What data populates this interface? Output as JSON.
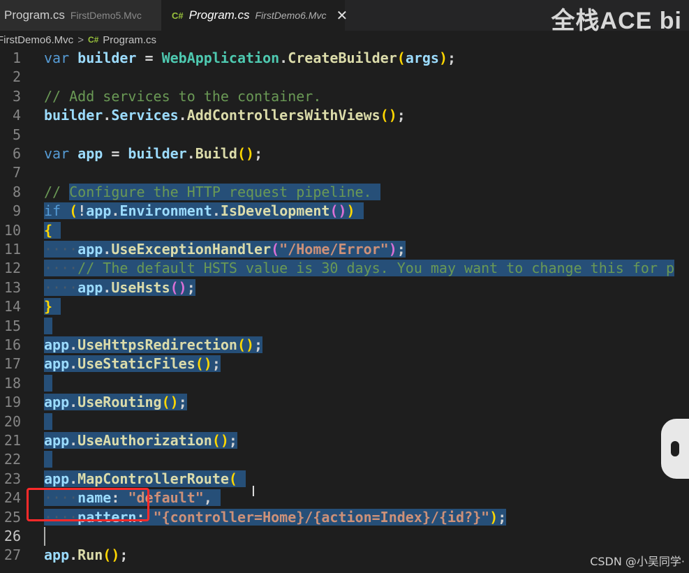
{
  "tabs": [
    {
      "filename": "Program.cs",
      "project": "FirstDemo5.Mvc",
      "active": false
    },
    {
      "icon": "C#",
      "filename": "Program.cs",
      "project": "FirstDemo6.Mvc",
      "active": true,
      "close": "✕"
    }
  ],
  "watermark": "全栈ACE bi",
  "breadcrumb": {
    "project": "FirstDemo6.Mvc",
    "separator": ">",
    "icon": "C#",
    "file": "Program.cs"
  },
  "active_line": 26,
  "csdn": "CSDN @小吴同学·",
  "lines": [
    {
      "n": "1",
      "segs": [
        [
          "kw",
          "var"
        ],
        [
          "plain",
          " "
        ],
        [
          "ident",
          "builder"
        ],
        [
          "plain",
          " = "
        ],
        [
          "cls",
          "WebApplication"
        ],
        [
          "plain",
          "."
        ],
        [
          "fn",
          "CreateBuilder"
        ],
        [
          "p1",
          "("
        ],
        [
          "ident",
          "args"
        ],
        [
          "p1",
          ")"
        ],
        [
          "plain",
          ";"
        ]
      ]
    },
    {
      "n": "2",
      "segs": []
    },
    {
      "n": "3",
      "segs": [
        [
          "cmt",
          "// Add services to the container."
        ]
      ]
    },
    {
      "n": "4",
      "segs": [
        [
          "ident",
          "builder"
        ],
        [
          "plain",
          "."
        ],
        [
          "ident",
          "Services"
        ],
        [
          "plain",
          "."
        ],
        [
          "fn",
          "AddControllersWithViews"
        ],
        [
          "p1",
          "()"
        ],
        [
          "plain",
          ";"
        ]
      ]
    },
    {
      "n": "5",
      "segs": []
    },
    {
      "n": "6",
      "segs": [
        [
          "kw",
          "var"
        ],
        [
          "plain",
          " "
        ],
        [
          "ident",
          "app"
        ],
        [
          "plain",
          " = "
        ],
        [
          "ident",
          "builder"
        ],
        [
          "plain",
          "."
        ],
        [
          "fn",
          "Build"
        ],
        [
          "p1",
          "()"
        ],
        [
          "plain",
          ";"
        ]
      ]
    },
    {
      "n": "7",
      "segs": []
    },
    {
      "n": "8",
      "sel": [
        0,
        0
      ],
      "seltext": true,
      "segs": [
        [
          "cmt",
          "// "
        ],
        [
          "cmt",
          "Configure the HTTP request pipeline. ",
          "sel"
        ]
      ]
    },
    {
      "n": "9",
      "selall": true,
      "segs": [
        [
          "kw",
          "if"
        ],
        [
          "plain",
          " "
        ],
        [
          "p1",
          "("
        ],
        [
          "plain",
          "!"
        ],
        [
          "ident",
          "app"
        ],
        [
          "plain",
          "."
        ],
        [
          "ident",
          "Environment"
        ],
        [
          "plain",
          "."
        ],
        [
          "fn",
          "IsDevelopment"
        ],
        [
          "p2",
          "()"
        ],
        [
          "p1",
          ")"
        ],
        [
          "plain",
          " "
        ]
      ]
    },
    {
      "n": "10",
      "selall": true,
      "segs": [
        [
          "p1",
          "{"
        ],
        [
          "plain",
          " "
        ]
      ]
    },
    {
      "n": "11",
      "selall": true,
      "segs": [
        [
          "ws",
          "····"
        ],
        [
          "ident",
          "app"
        ],
        [
          "plain",
          "."
        ],
        [
          "fn",
          "UseExceptionHandler"
        ],
        [
          "p2",
          "("
        ],
        [
          "str",
          "\"/Home/Error\""
        ],
        [
          "p2",
          ")"
        ],
        [
          "plain",
          ";"
        ]
      ]
    },
    {
      "n": "12",
      "selall": true,
      "segs": [
        [
          "ws",
          "····"
        ],
        [
          "cmt",
          "// The default HSTS value is 30 days. You may want to change this for p"
        ]
      ]
    },
    {
      "n": "13",
      "selall": true,
      "segs": [
        [
          "ws",
          "····"
        ],
        [
          "ident",
          "app"
        ],
        [
          "plain",
          "."
        ],
        [
          "fn",
          "UseHsts"
        ],
        [
          "p2",
          "()"
        ],
        [
          "plain",
          ";"
        ]
      ]
    },
    {
      "n": "14",
      "selall": true,
      "segs": [
        [
          "p1",
          "}"
        ],
        [
          "plain",
          " "
        ]
      ]
    },
    {
      "n": "15",
      "selall": true,
      "segs": [
        [
          "plain",
          " "
        ]
      ]
    },
    {
      "n": "16",
      "selall": true,
      "segs": [
        [
          "ident",
          "app"
        ],
        [
          "plain",
          "."
        ],
        [
          "fn",
          "UseHttpsRedirection"
        ],
        [
          "p1",
          "()"
        ],
        [
          "plain",
          ";"
        ]
      ]
    },
    {
      "n": "17",
      "selall": true,
      "segs": [
        [
          "ident",
          "app"
        ],
        [
          "plain",
          "."
        ],
        [
          "fn",
          "UseStaticFiles"
        ],
        [
          "p1",
          "()"
        ],
        [
          "plain",
          ";"
        ]
      ]
    },
    {
      "n": "18",
      "selall": true,
      "segs": [
        [
          "plain",
          " "
        ]
      ]
    },
    {
      "n": "19",
      "selall": true,
      "segs": [
        [
          "ident",
          "app"
        ],
        [
          "plain",
          "."
        ],
        [
          "fn",
          "UseRouting"
        ],
        [
          "p1",
          "()"
        ],
        [
          "plain",
          ";"
        ]
      ]
    },
    {
      "n": "20",
      "selall": true,
      "segs": [
        [
          "plain",
          " "
        ]
      ]
    },
    {
      "n": "21",
      "selall": true,
      "segs": [
        [
          "ident",
          "app"
        ],
        [
          "plain",
          "."
        ],
        [
          "fn",
          "UseAuthorization"
        ],
        [
          "p1",
          "()"
        ],
        [
          "plain",
          ";"
        ]
      ]
    },
    {
      "n": "22",
      "selall": true,
      "segs": [
        [
          "plain",
          " "
        ]
      ]
    },
    {
      "n": "23",
      "selall": true,
      "segs": [
        [
          "ident",
          "app"
        ],
        [
          "plain",
          "."
        ],
        [
          "fn",
          "MapControllerRoute"
        ],
        [
          "p1",
          "("
        ],
        [
          "plain",
          " "
        ]
      ]
    },
    {
      "n": "24",
      "selall": true,
      "segs": [
        [
          "ws",
          "····"
        ],
        [
          "ident",
          "name"
        ],
        [
          "plain",
          ": "
        ],
        [
          "str",
          "\"default\""
        ],
        [
          "plain",
          ", "
        ]
      ]
    },
    {
      "n": "25",
      "selall": true,
      "segs": [
        [
          "ws",
          "····"
        ],
        [
          "ident",
          "pattern"
        ],
        [
          "plain",
          ": "
        ],
        [
          "str",
          "\"{controller=Home}/{action=Index}/{id?}\""
        ],
        [
          "p1",
          ")"
        ],
        [
          "plain",
          ";"
        ]
      ]
    },
    {
      "n": "26",
      "segs": []
    },
    {
      "n": "27",
      "segs": [
        [
          "ident",
          "app"
        ],
        [
          "plain",
          "."
        ],
        [
          "fn",
          "Run"
        ],
        [
          "p1",
          "()"
        ],
        [
          "plain",
          ";"
        ]
      ]
    }
  ]
}
